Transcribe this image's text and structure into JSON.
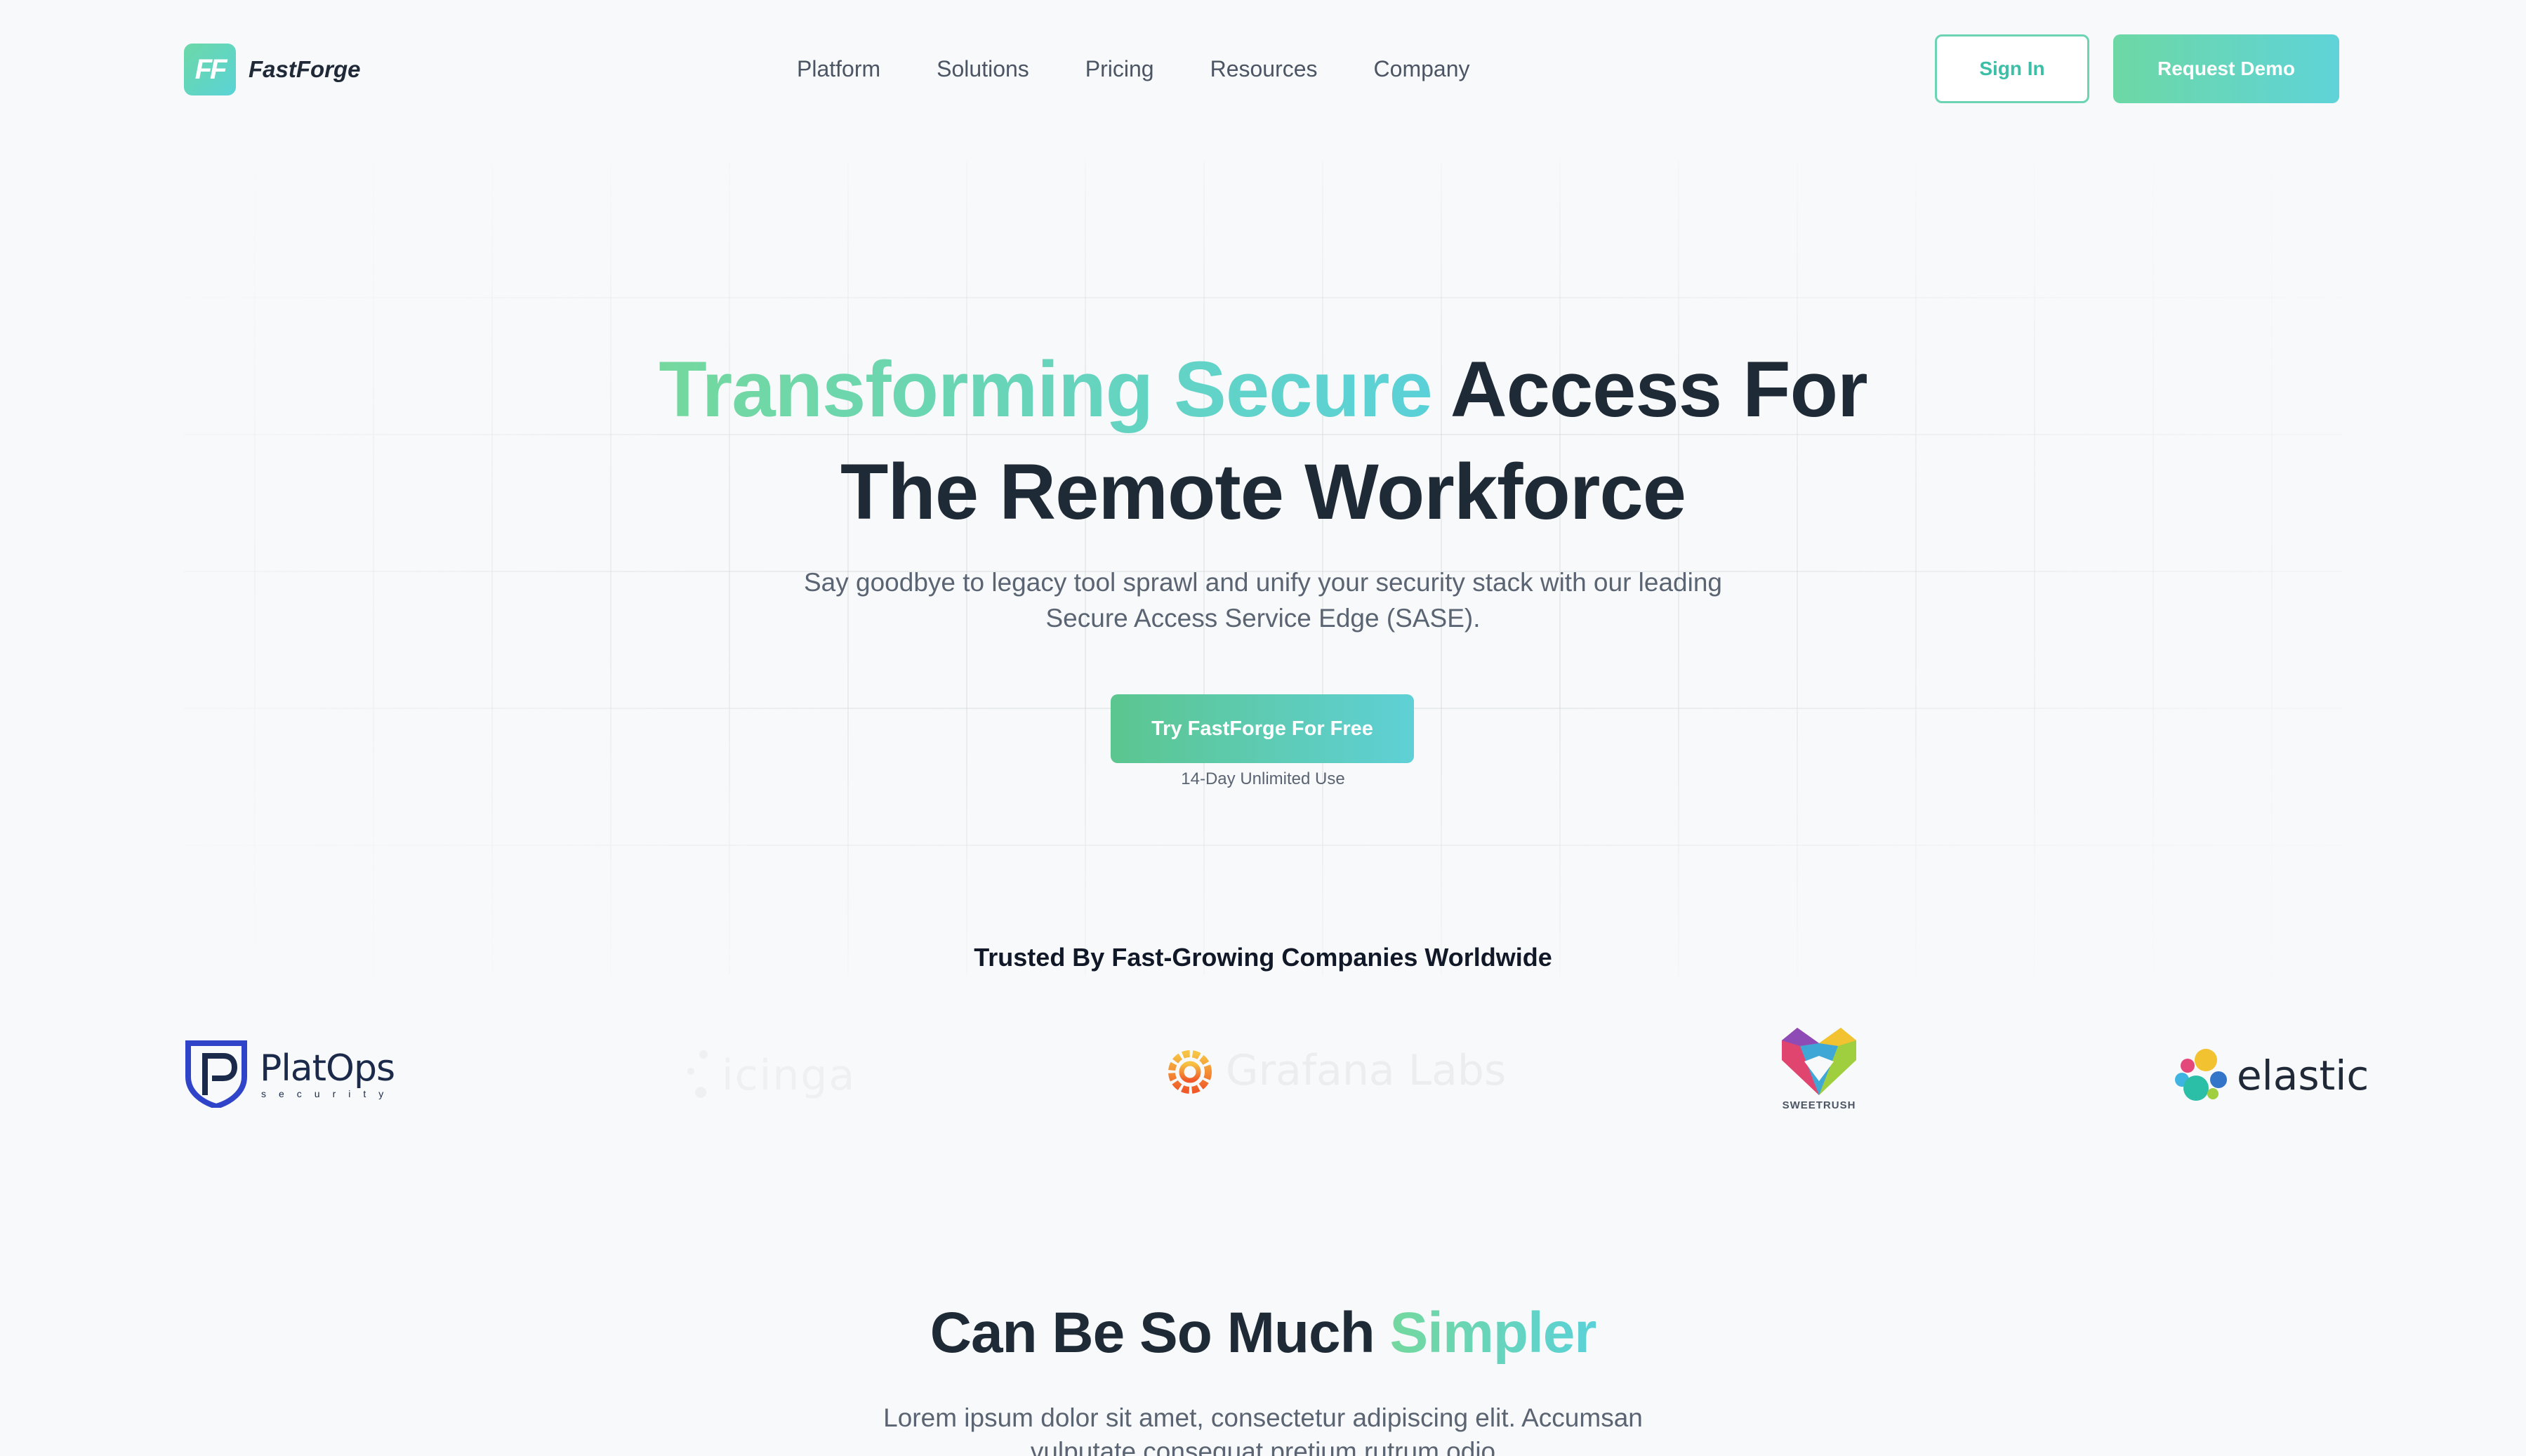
{
  "brand": {
    "name": "FastForge",
    "mark": "FF"
  },
  "nav": [
    "Platform",
    "Solutions",
    "Pricing",
    "Resources",
    "Company"
  ],
  "header_actions": {
    "signin": "Sign In",
    "demo": "Request Demo"
  },
  "hero": {
    "title_accent": "Transforming Secure",
    "title_rest_line1": "Access For",
    "title_line2": "The Remote Workforce",
    "subtitle": "Say goodbye to legacy tool sprawl and unify your security stack with our leading Secure Access Service Edge (SASE).",
    "cta": "Try FastForge For Free",
    "cta_note": "14-Day Unlimited Use"
  },
  "trusted": {
    "heading": "Trusted By Fast-Growing Companies Worldwide",
    "logos": {
      "platops": {
        "name": "PlatOps",
        "tag": "security"
      },
      "icinga": {
        "name": "icinga"
      },
      "grafana": {
        "name": "Grafana Labs"
      },
      "sweetrush": {
        "name": "SWEETRUSH"
      },
      "elastic": {
        "name": "elastic"
      }
    }
  },
  "section2": {
    "title_plain": "Can Be So Much",
    "title_accent": "Simpler",
    "subtitle": "Lorem ipsum dolor sit amet, consectetur adipiscing elit. Accumsan vulputate consequat pretium rutrum odio"
  },
  "colors": {
    "accent_start": "#74d89e",
    "accent_end": "#5ad1d8",
    "heading": "#1f2a37"
  }
}
